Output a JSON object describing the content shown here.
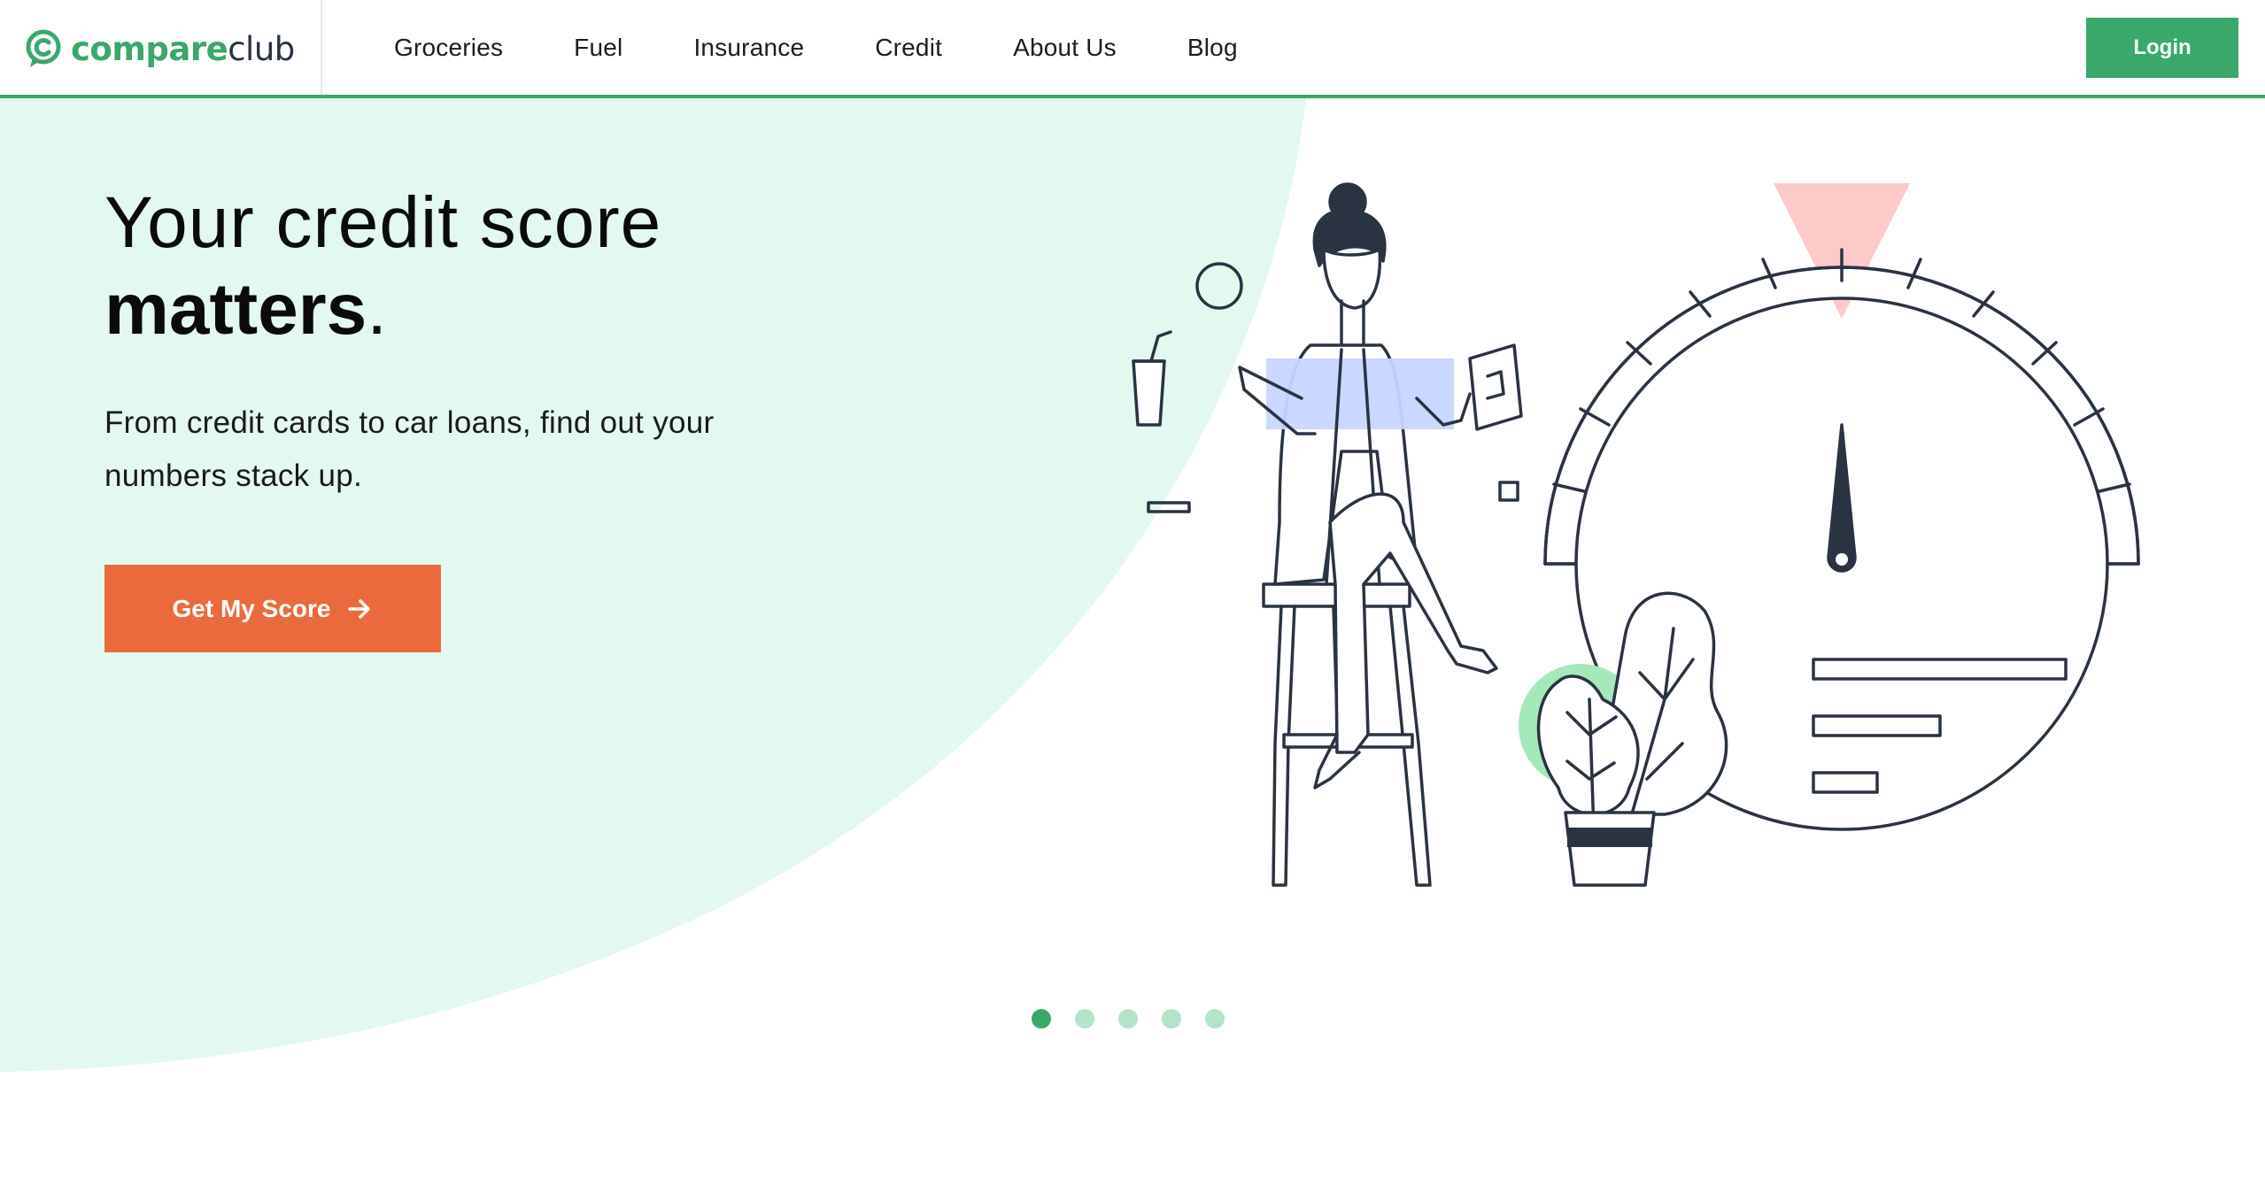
{
  "brand": {
    "logo_compare": "compare",
    "logo_club": "club",
    "accent_color": "#3aa86a",
    "cta_color": "#eb6a3d",
    "hero_bg_color": "#e3f8ee"
  },
  "nav": {
    "items": [
      {
        "label": "Groceries"
      },
      {
        "label": "Fuel"
      },
      {
        "label": "Insurance"
      },
      {
        "label": "Credit"
      },
      {
        "label": "About Us"
      },
      {
        "label": "Blog"
      }
    ],
    "login_label": "Login"
  },
  "hero": {
    "title_line1": "Your credit score",
    "title_line2": "matters",
    "title_period": ".",
    "subtitle": "From credit cards to car loans, find out your numbers stack up.",
    "cta_label": "Get My Score",
    "cta_icon": "arrow-right-icon",
    "illustration": "woman-on-stool-with-credit-score-gauge-illustration"
  },
  "carousel": {
    "slide_count": 5,
    "active_index": 0
  }
}
